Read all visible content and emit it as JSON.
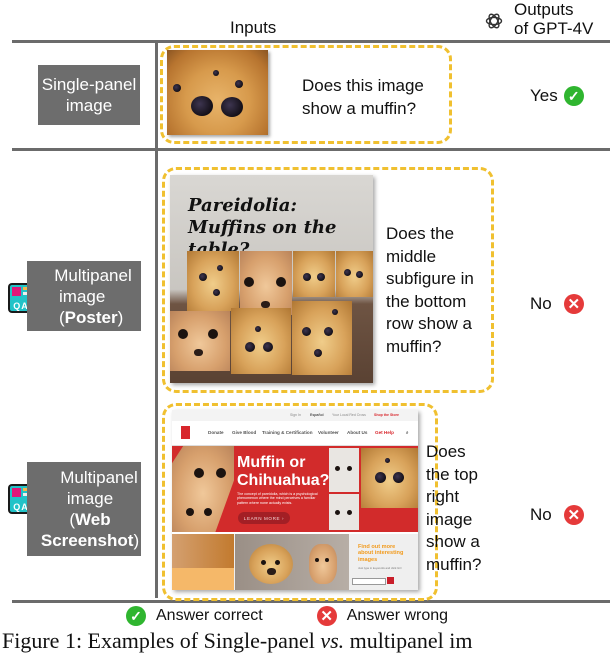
{
  "header": {
    "inputs_label": "Inputs",
    "outputs_label_line1": "Outputs",
    "outputs_label_line2": "of GPT-4V",
    "model_icon": "openai-logo-icon"
  },
  "rows": [
    {
      "type_label_line1": "Single-panel",
      "type_label_line2": "image",
      "image_desc": "close-up of a blueberry muffin",
      "question": [
        "Does this image",
        "show a muffin?"
      ],
      "answer": "Yes",
      "answer_status": "correct"
    },
    {
      "type_label_line1": "Multipanel",
      "type_label_line2": "image",
      "type_label_paren_open": "(",
      "type_label_bold": "Poster",
      "type_label_paren_close": ")",
      "icon": "qa-panel-icon",
      "poster": {
        "title_line1": "Pareidolia:",
        "title_line2": "Muffins on the table?"
      },
      "question": [
        "Does the",
        "middle",
        "subfigure in",
        "the bottom",
        "row show a",
        "muffin?"
      ],
      "answer": "No",
      "answer_status": "wrong"
    },
    {
      "type_label_line1": "Multipanel",
      "type_label_line2": "image",
      "type_label_paren_open": "(",
      "type_label_bold_line1": "Web",
      "type_label_bold_line2": "Screenshot",
      "type_label_paren_close": ")",
      "icon": "qa-panel-icon",
      "web": {
        "topbar": [
          "Sign In",
          "Español",
          "Your Local Red Cross",
          "Shop the Store"
        ],
        "nav": [
          "Donate",
          "Give Blood",
          "Training & Certification",
          "Volunteer",
          "About Us",
          "Get Help"
        ],
        "hero_title_line1": "Muffin or",
        "hero_title_line2": "Chihuahua?",
        "hero_text": "The concept of pareidolia, which is a psychological phenomenon where the mind perceives a familiar pattern where none actually exists.",
        "hero_button": "LEARN MORE ›",
        "promo_line1": "Find out more",
        "promo_line2": "about interesting",
        "promo_line3": "images",
        "promo_sub": "Just type in keywords and click GO",
        "go_label": "GO"
      },
      "question": [
        "Does",
        "the top",
        "right",
        "image",
        "show a",
        "muffin?"
      ],
      "answer": "No",
      "answer_status": "wrong"
    }
  ],
  "legend": {
    "correct_label": "Answer correct",
    "wrong_label": "Answer wrong",
    "colors": {
      "correct": "#2fb52f",
      "wrong": "#e53a3a",
      "highlight_border": "#f0c030"
    }
  },
  "caption": {
    "prefix": "Figure 1: Examples of Single-panel ",
    "vs": "vs.",
    "suffix": " multipanel im"
  }
}
